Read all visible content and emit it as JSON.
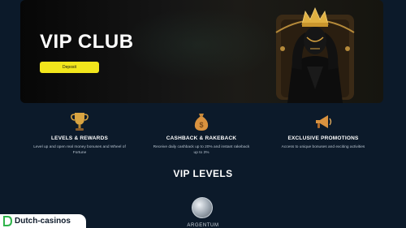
{
  "hero": {
    "title": "VIP CLUB",
    "button_label": "Deposit"
  },
  "features": [
    {
      "icon": "trophy-icon",
      "title": "LEVELS & REWARDS",
      "description": "Level up and open real money bonuses and Wheel of Fortune"
    },
    {
      "icon": "money-bag-icon",
      "title": "CASHBACK & RAKEBACK",
      "description": "Receive daily cashback up to 20% and instant rakeback up to 3%"
    },
    {
      "icon": "megaphone-icon",
      "title": "EXCLUSIVE PROMOTIONS",
      "description": "Access to unique bonuses and exciting activities"
    }
  ],
  "levels": {
    "title": "VIP LEVELS",
    "first_level": "ARGENTUM"
  },
  "watermark": {
    "text": "Dutch-casinos"
  },
  "colors": {
    "background": "#0c1a2a",
    "accent_button": "#f2e61c",
    "gold": "#d9a441"
  }
}
